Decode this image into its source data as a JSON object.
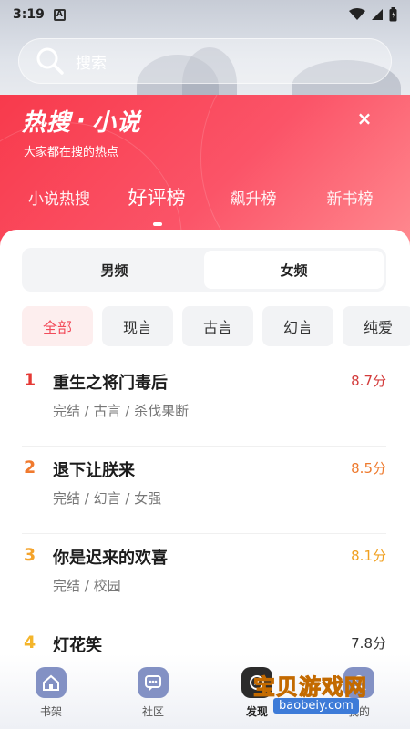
{
  "status_bar": {
    "time": "3:19",
    "notification_icon": "A"
  },
  "search": {
    "placeholder": "搜索"
  },
  "panel": {
    "title_part1": "热搜",
    "title_sep": "·",
    "title_part2": "小说",
    "subtitle": "大家都在搜的热点",
    "close_icon": "×"
  },
  "rank_tabs": [
    {
      "label": "小说热搜"
    },
    {
      "label": "好评榜",
      "active": true
    },
    {
      "label": "飙升榜"
    },
    {
      "label": "新书榜"
    }
  ],
  "gender": {
    "male": "男频",
    "female": "女频",
    "selected": "female"
  },
  "genres": [
    "全部",
    "现言",
    "古言",
    "幻言",
    "纯爱"
  ],
  "books": [
    {
      "rank": "1",
      "title": "重生之将门毒后",
      "meta": "完结 / 古言 / 杀伐果断",
      "score": "8.7分",
      "rank_color": "#e53935",
      "score_color": "#d33b3b"
    },
    {
      "rank": "2",
      "title": "退下让朕来",
      "meta": "完结 / 幻言 / 女强",
      "score": "8.5分",
      "rank_color": "#f07a2e",
      "score_color": "#ee7a2e"
    },
    {
      "rank": "3",
      "title": "你是迟来的欢喜",
      "meta": "完结 / 校园",
      "score": "8.1分",
      "rank_color": "#f4a32b",
      "score_color": "#f0a020"
    },
    {
      "rank": "4",
      "title": "灯花笑",
      "meta": "",
      "score": "7.8分",
      "rank_color": "#f4b52b",
      "score_color": "#333333"
    }
  ],
  "tabbar": [
    {
      "label": "书架",
      "icon": "home-icon"
    },
    {
      "label": "社区",
      "icon": "chat-icon"
    },
    {
      "label": "发现",
      "icon": "discover-icon",
      "active": true
    },
    {
      "label": "我的",
      "icon": "profile-icon"
    }
  ],
  "watermark": {
    "text": "宝贝游戏网",
    "url": "baobeiy.com"
  },
  "colors": {
    "accent": "#f83a4c",
    "chip_active_text": "#f24b5a"
  }
}
